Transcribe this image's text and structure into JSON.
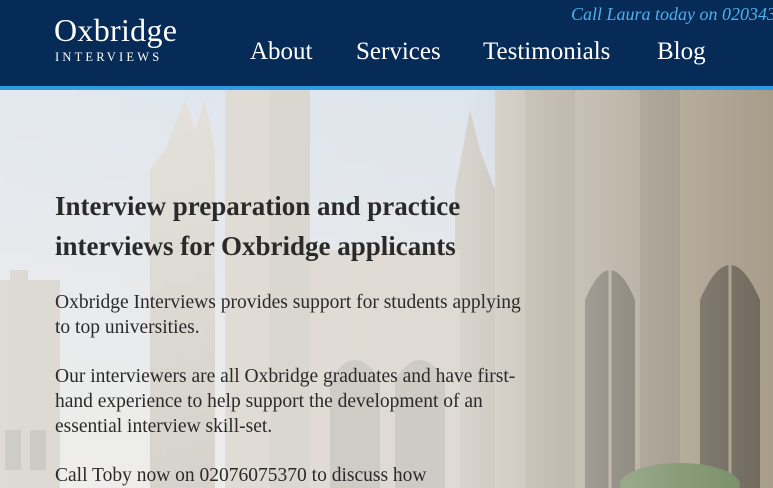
{
  "header": {
    "logo_main": "Oxbridge",
    "logo_sub": "INTERVIEWS",
    "call_text": "Call Laura today on 020343"
  },
  "nav": {
    "items": [
      {
        "label": "About"
      },
      {
        "label": "Services"
      },
      {
        "label": "Testimonials"
      },
      {
        "label": "Blog"
      }
    ]
  },
  "main": {
    "heading": "Interview preparation and practice interviews for Oxbridge applicants",
    "paragraphs": [
      "Oxbridge Interviews provides support for students applying to top universities.",
      "Our interviewers are all Oxbridge graduates and have first-hand experience to help support the development of an essential interview skill-set.",
      "Call Toby now on 02076075370 to discuss how"
    ]
  },
  "colors": {
    "header_bg": "#072b57",
    "accent": "#2f9be3",
    "phone_text": "#4fb0ec"
  }
}
